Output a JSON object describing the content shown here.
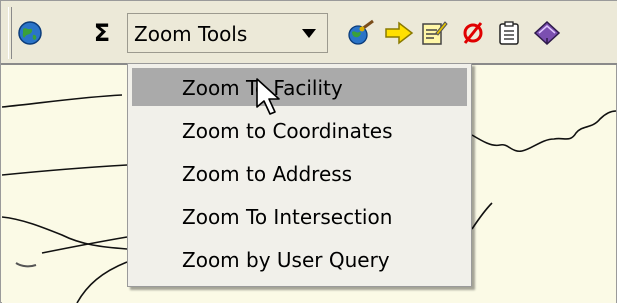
{
  "toolbar": {
    "combo": {
      "selected": "Zoom Tools"
    },
    "icons": [
      {
        "name": "globe-icon",
        "glyph": "●",
        "color": "#1f6fbf"
      },
      {
        "name": "sigma-icon",
        "glyph": "Σ",
        "color": "#000000"
      },
      {
        "name": "globe-brush-icon",
        "glyph": "●",
        "color": "#2a7fce"
      },
      {
        "name": "arrow-right-icon",
        "glyph": "➡",
        "color": "#ffd400"
      },
      {
        "name": "edit-note-icon",
        "glyph": "■",
        "color": "#e0d04a"
      },
      {
        "name": "no-entry-icon",
        "glyph": "Ø",
        "color": "#e00000"
      },
      {
        "name": "clipboard-icon",
        "glyph": "▤",
        "color": "#333333"
      },
      {
        "name": "book-icon",
        "glyph": "◆",
        "color": "#6b3fa0"
      }
    ]
  },
  "menu": {
    "items": [
      {
        "label": "Zoom To Facility"
      },
      {
        "label": "Zoom to Coordinates"
      },
      {
        "label": "Zoom to Address"
      },
      {
        "label": "Zoom To Intersection"
      },
      {
        "label": "Zoom by User Query"
      }
    ],
    "hover_index": 0
  },
  "colors": {
    "map_background": "#fbfae6",
    "toolbar_background": "#ece9d8",
    "menu_background": "#f1f0ea",
    "menu_hover": "#aaaaaa"
  }
}
